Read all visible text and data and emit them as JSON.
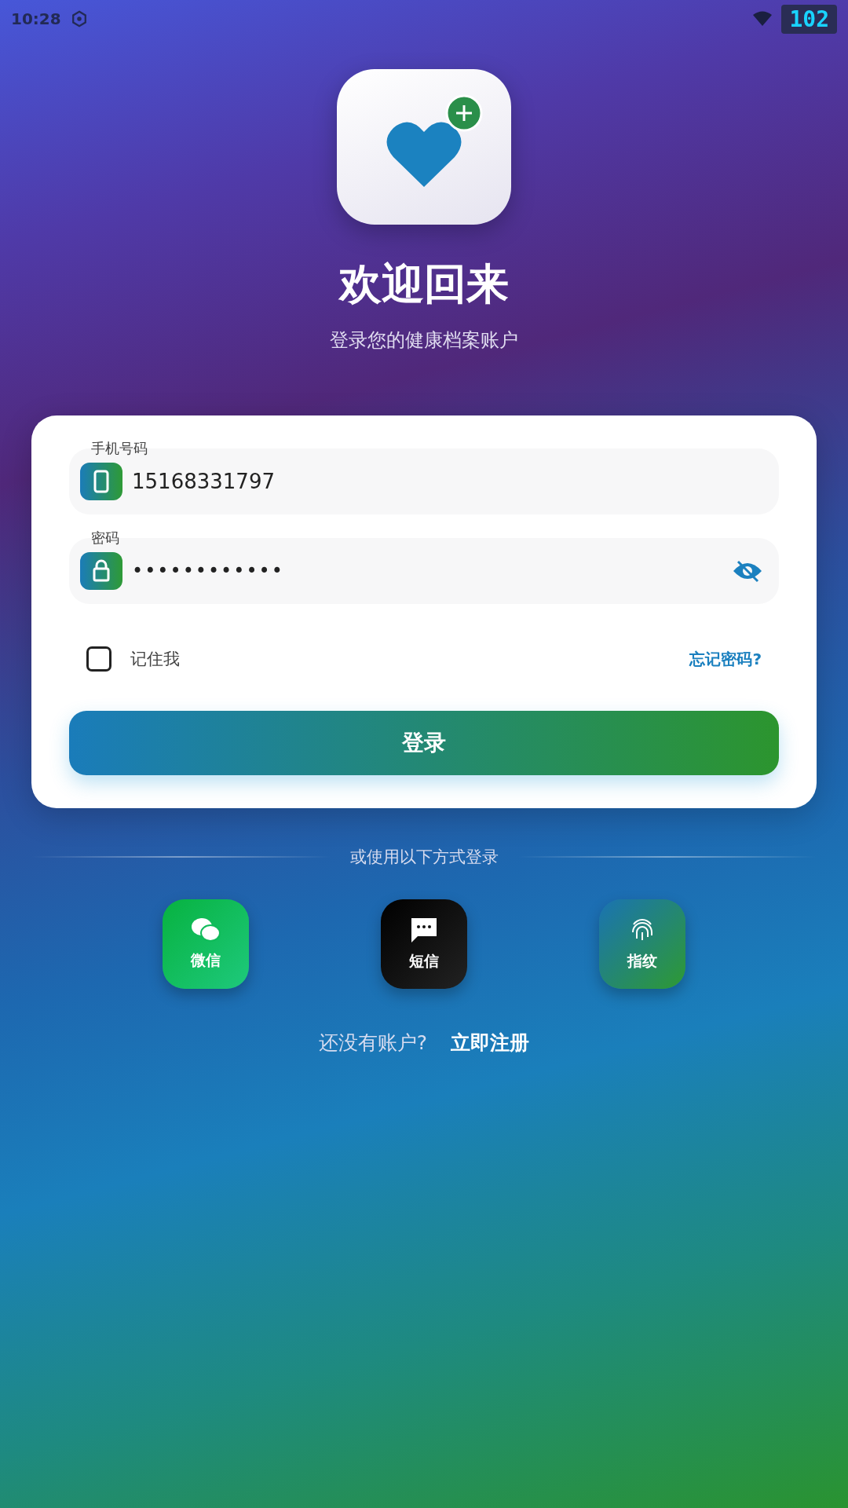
{
  "status_bar": {
    "time": "10:28",
    "badge": "102"
  },
  "header": {
    "title": "欢迎回来",
    "subtitle": "登录您的健康档案账户"
  },
  "form": {
    "phone": {
      "label": "手机号码",
      "value": "15168331797"
    },
    "password": {
      "label": "密码",
      "value": "••••••••••••"
    },
    "remember": {
      "label": "记住我",
      "checked": false
    },
    "forgot_link": "忘记密码?",
    "submit": "登录"
  },
  "alt_login": {
    "divider_text": "或使用以下方式登录",
    "options": [
      {
        "kind": "wechat",
        "label": "微信"
      },
      {
        "kind": "sms",
        "label": "短信"
      },
      {
        "kind": "fingerprint",
        "label": "指纹"
      }
    ]
  },
  "register": {
    "prompt": "还没有账户?",
    "link": "立即注册"
  }
}
